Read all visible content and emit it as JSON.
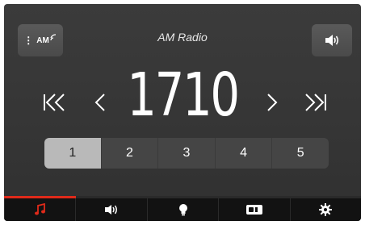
{
  "header": {
    "source_button": {
      "label": "AM",
      "icon": "menu-dots-icon"
    },
    "title": "AM Radio",
    "volume_button": {
      "icon": "speaker-icon"
    }
  },
  "tuner": {
    "frequency": "1710",
    "controls": [
      "seek-back-icon",
      "step-back-icon",
      "step-forward-icon",
      "seek-forward-icon"
    ]
  },
  "presets": {
    "items": [
      "1",
      "2",
      "3",
      "4",
      "5"
    ],
    "selected": "1"
  },
  "bottom_bar": {
    "tabs": [
      "music-note-icon",
      "volume-icon",
      "light-bulb-icon",
      "phone-display-icon",
      "gear-icon"
    ],
    "active_tab": "music-note-icon",
    "accent_color": "#e02a1a"
  }
}
